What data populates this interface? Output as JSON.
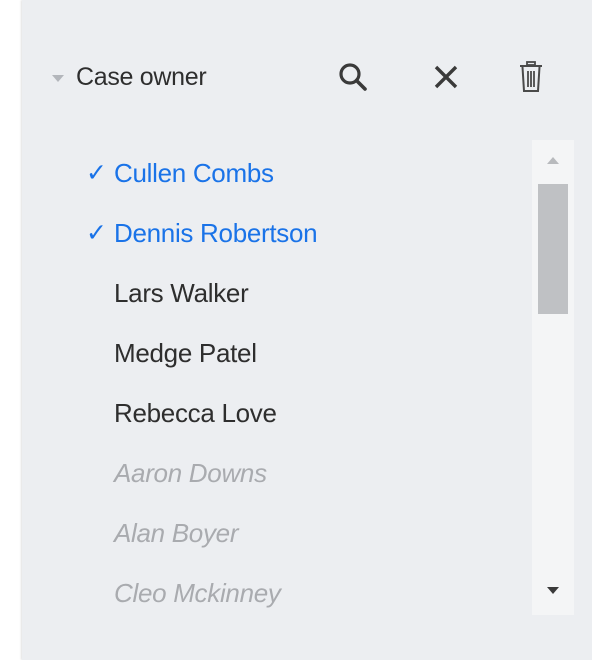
{
  "filter": {
    "title": "Case owner",
    "icons": {
      "collapse": "caret-down-icon",
      "search": "search-icon",
      "clear": "close-icon",
      "delete": "trash-icon"
    }
  },
  "options": [
    {
      "label": "Cullen Combs",
      "state": "selected"
    },
    {
      "label": "Dennis Robertson",
      "state": "selected"
    },
    {
      "label": "Lars Walker",
      "state": "normal"
    },
    {
      "label": "Medge Patel",
      "state": "normal"
    },
    {
      "label": "Rebecca Love",
      "state": "normal"
    },
    {
      "label": "Aaron Downs",
      "state": "disabled"
    },
    {
      "label": "Alan Boyer",
      "state": "disabled"
    },
    {
      "label": "Cleo Mckinney",
      "state": "disabled"
    }
  ],
  "check_glyph": "✓",
  "colors": {
    "selected": "#1a73e8",
    "normal": "#2e2e2e",
    "disabled": "#a9abaf",
    "panel_background": "#eceef1"
  }
}
